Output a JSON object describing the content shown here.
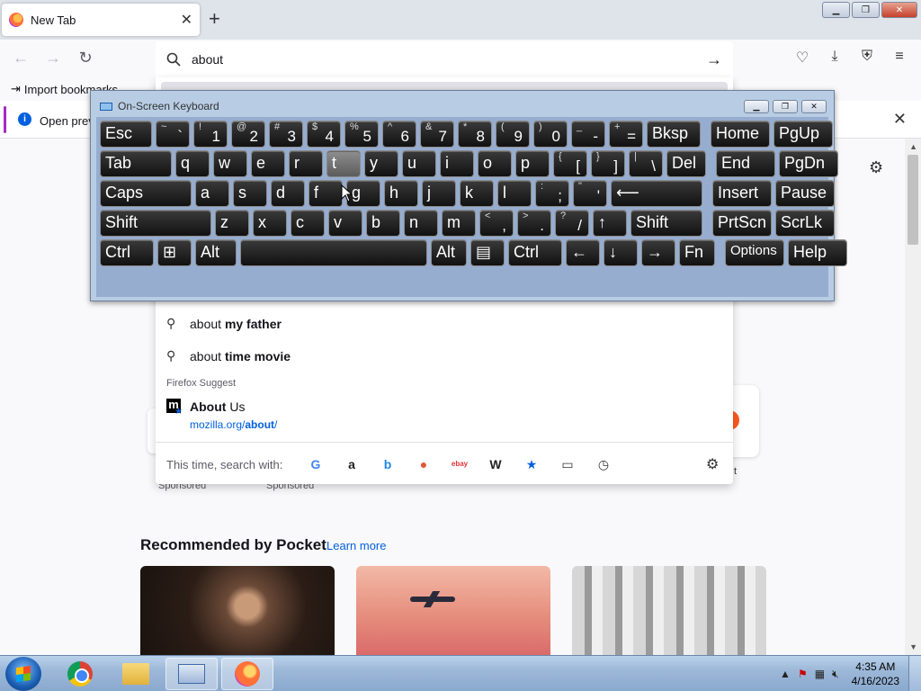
{
  "browser": {
    "tab_title": "New Tab",
    "tab_close": "✕",
    "new_tab": "+",
    "url_value": "about",
    "bookmark_import": "Import bookmarks",
    "info_text": "Open previ"
  },
  "window_controls": {
    "minimize": "▁",
    "restore": "❐",
    "close": "✕"
  },
  "dropdown": {
    "suggestions": [
      {
        "prefix": "about ",
        "bold": "my father"
      },
      {
        "prefix": "about ",
        "bold": "time movie"
      }
    ],
    "section_label": "Firefox Suggest",
    "result_title_bold": "About",
    "result_title_rest": " Us",
    "result_url_host": "mozilla.org/",
    "result_url_path": "about",
    "result_url_tail": "/",
    "search_with_label": "This time, search with:",
    "engines": [
      {
        "name": "google",
        "glyph": "G",
        "color": "#4285f4"
      },
      {
        "name": "amazon",
        "glyph": "a",
        "color": "#222222"
      },
      {
        "name": "bing",
        "glyph": "b",
        "color": "#1e88e5"
      },
      {
        "name": "duckduckgo",
        "glyph": "●",
        "color": "#de5833"
      },
      {
        "name": "ebay",
        "glyph": "ebay",
        "color": "#e53238"
      },
      {
        "name": "wikipedia",
        "glyph": "W",
        "color": "#222222"
      },
      {
        "name": "bookmarks",
        "glyph": "★",
        "color": "#0060df"
      },
      {
        "name": "tabs",
        "glyph": "▭",
        "color": "#333333"
      },
      {
        "name": "history",
        "glyph": "◷",
        "color": "#333333"
      }
    ]
  },
  "page": {
    "sponsored_1": "Sponsored",
    "sponsored_2": "Sponsored",
    "pocket_title": "Recommended by Pocket",
    "pocket_link": "Learn more",
    "partial_t": "t"
  },
  "osk": {
    "title": "On-Screen Keyboard",
    "rows": [
      [
        {
          "id": "esc",
          "label": "Esc"
        },
        {
          "id": "tilde",
          "shift": "~",
          "base": "`"
        },
        {
          "id": "1",
          "shift": "!",
          "base": "1"
        },
        {
          "id": "2",
          "shift": "@",
          "base": "2"
        },
        {
          "id": "3",
          "shift": "#",
          "base": "3"
        },
        {
          "id": "4",
          "shift": "$",
          "base": "4"
        },
        {
          "id": "5",
          "shift": "%",
          "base": "5"
        },
        {
          "id": "6",
          "shift": "^",
          "base": "6"
        },
        {
          "id": "7",
          "shift": "&",
          "base": "7"
        },
        {
          "id": "8",
          "shift": "*",
          "base": "8"
        },
        {
          "id": "9",
          "shift": "(",
          "base": "9"
        },
        {
          "id": "0",
          "shift": ")",
          "base": "0"
        },
        {
          "id": "minus",
          "shift": "_",
          "base": "-"
        },
        {
          "id": "equals",
          "shift": "+",
          "base": "="
        },
        {
          "id": "bksp",
          "label": "Bksp"
        },
        {
          "id": "home",
          "label": "Home"
        },
        {
          "id": "pgup",
          "label": "PgUp"
        }
      ],
      [
        {
          "id": "tab",
          "label": "Tab"
        },
        {
          "id": "q",
          "label": "q"
        },
        {
          "id": "w",
          "label": "w"
        },
        {
          "id": "e",
          "label": "e"
        },
        {
          "id": "r",
          "label": "r"
        },
        {
          "id": "t",
          "label": "t",
          "highlight": true
        },
        {
          "id": "y",
          "label": "y"
        },
        {
          "id": "u",
          "label": "u"
        },
        {
          "id": "i",
          "label": "i"
        },
        {
          "id": "o",
          "label": "o"
        },
        {
          "id": "p",
          "label": "p"
        },
        {
          "id": "lbracket",
          "shift": "{",
          "base": "["
        },
        {
          "id": "rbracket",
          "shift": "}",
          "base": "]"
        },
        {
          "id": "backslash",
          "shift": "|",
          "base": "\\"
        },
        {
          "id": "del",
          "label": "Del"
        },
        {
          "id": "end",
          "label": "End"
        },
        {
          "id": "pgdn",
          "label": "PgDn"
        }
      ],
      [
        {
          "id": "caps",
          "label": "Caps"
        },
        {
          "id": "a",
          "label": "a"
        },
        {
          "id": "s",
          "label": "s"
        },
        {
          "id": "d",
          "label": "d"
        },
        {
          "id": "f",
          "label": "f"
        },
        {
          "id": "g",
          "label": "g"
        },
        {
          "id": "h",
          "label": "h"
        },
        {
          "id": "j",
          "label": "j"
        },
        {
          "id": "k",
          "label": "k"
        },
        {
          "id": "l",
          "label": "l"
        },
        {
          "id": "semicolon",
          "shift": ":",
          "base": ";"
        },
        {
          "id": "quote",
          "shift": "\"",
          "base": "'"
        },
        {
          "id": "enter",
          "label": "⟵"
        },
        {
          "id": "insert",
          "label": "Insert"
        },
        {
          "id": "pause",
          "label": "Pause"
        }
      ],
      [
        {
          "id": "lshift",
          "label": "Shift"
        },
        {
          "id": "z",
          "label": "z"
        },
        {
          "id": "x",
          "label": "x"
        },
        {
          "id": "c",
          "label": "c"
        },
        {
          "id": "v",
          "label": "v"
        },
        {
          "id": "b",
          "label": "b"
        },
        {
          "id": "n",
          "label": "n"
        },
        {
          "id": "m",
          "label": "m"
        },
        {
          "id": "comma",
          "shift": "<",
          "base": ","
        },
        {
          "id": "period",
          "shift": ">",
          "base": "."
        },
        {
          "id": "slash",
          "shift": "?",
          "base": "/"
        },
        {
          "id": "up",
          "label": "↑"
        },
        {
          "id": "rshift",
          "label": "Shift"
        },
        {
          "id": "prtscn",
          "label": "PrtScn"
        },
        {
          "id": "scrlk",
          "label": "ScrLk"
        }
      ],
      [
        {
          "id": "lctrl",
          "label": "Ctrl"
        },
        {
          "id": "win",
          "label": "⊞"
        },
        {
          "id": "lalt",
          "label": "Alt"
        },
        {
          "id": "space",
          "label": ""
        },
        {
          "id": "ralt",
          "label": "Alt"
        },
        {
          "id": "menu",
          "label": "▤"
        },
        {
          "id": "rctrl",
          "label": "Ctrl"
        },
        {
          "id": "left",
          "label": "←"
        },
        {
          "id": "down",
          "label": "↓"
        },
        {
          "id": "right",
          "label": "→"
        },
        {
          "id": "fn",
          "label": "Fn"
        },
        {
          "id": "options",
          "label": "Options",
          "small": true
        },
        {
          "id": "help",
          "label": "Help"
        }
      ]
    ]
  },
  "taskbar": {
    "time": "4:35 AM",
    "date": "4/16/2023",
    "tray_arrow": "▲"
  }
}
